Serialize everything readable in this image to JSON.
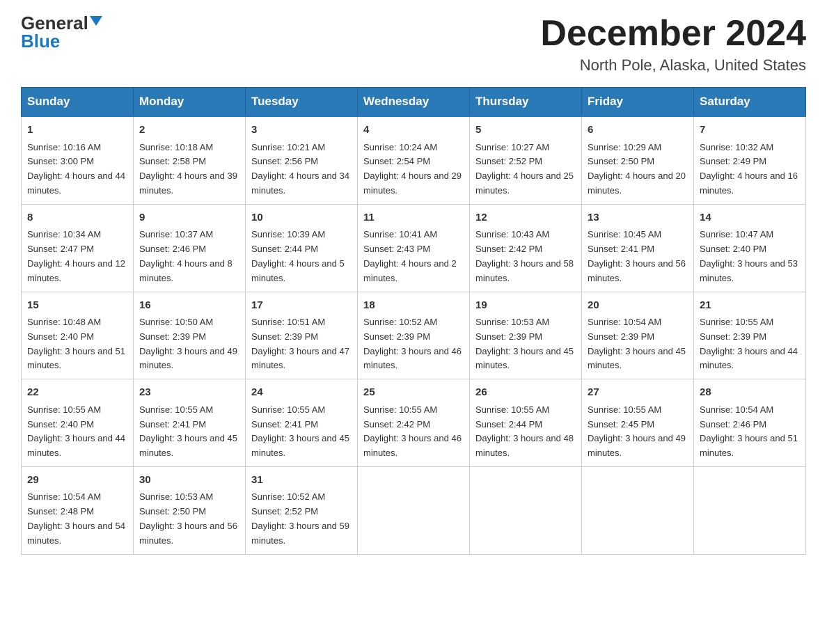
{
  "logo": {
    "general": "General",
    "blue": "Blue"
  },
  "title": "December 2024",
  "subtitle": "North Pole, Alaska, United States",
  "days_of_week": [
    "Sunday",
    "Monday",
    "Tuesday",
    "Wednesday",
    "Thursday",
    "Friday",
    "Saturday"
  ],
  "weeks": [
    [
      {
        "day": "1",
        "sunrise": "10:16 AM",
        "sunset": "3:00 PM",
        "daylight": "4 hours and 44 minutes."
      },
      {
        "day": "2",
        "sunrise": "10:18 AM",
        "sunset": "2:58 PM",
        "daylight": "4 hours and 39 minutes."
      },
      {
        "day": "3",
        "sunrise": "10:21 AM",
        "sunset": "2:56 PM",
        "daylight": "4 hours and 34 minutes."
      },
      {
        "day": "4",
        "sunrise": "10:24 AM",
        "sunset": "2:54 PM",
        "daylight": "4 hours and 29 minutes."
      },
      {
        "day": "5",
        "sunrise": "10:27 AM",
        "sunset": "2:52 PM",
        "daylight": "4 hours and 25 minutes."
      },
      {
        "day": "6",
        "sunrise": "10:29 AM",
        "sunset": "2:50 PM",
        "daylight": "4 hours and 20 minutes."
      },
      {
        "day": "7",
        "sunrise": "10:32 AM",
        "sunset": "2:49 PM",
        "daylight": "4 hours and 16 minutes."
      }
    ],
    [
      {
        "day": "8",
        "sunrise": "10:34 AM",
        "sunset": "2:47 PM",
        "daylight": "4 hours and 12 minutes."
      },
      {
        "day": "9",
        "sunrise": "10:37 AM",
        "sunset": "2:46 PM",
        "daylight": "4 hours and 8 minutes."
      },
      {
        "day": "10",
        "sunrise": "10:39 AM",
        "sunset": "2:44 PM",
        "daylight": "4 hours and 5 minutes."
      },
      {
        "day": "11",
        "sunrise": "10:41 AM",
        "sunset": "2:43 PM",
        "daylight": "4 hours and 2 minutes."
      },
      {
        "day": "12",
        "sunrise": "10:43 AM",
        "sunset": "2:42 PM",
        "daylight": "3 hours and 58 minutes."
      },
      {
        "day": "13",
        "sunrise": "10:45 AM",
        "sunset": "2:41 PM",
        "daylight": "3 hours and 56 minutes."
      },
      {
        "day": "14",
        "sunrise": "10:47 AM",
        "sunset": "2:40 PM",
        "daylight": "3 hours and 53 minutes."
      }
    ],
    [
      {
        "day": "15",
        "sunrise": "10:48 AM",
        "sunset": "2:40 PM",
        "daylight": "3 hours and 51 minutes."
      },
      {
        "day": "16",
        "sunrise": "10:50 AM",
        "sunset": "2:39 PM",
        "daylight": "3 hours and 49 minutes."
      },
      {
        "day": "17",
        "sunrise": "10:51 AM",
        "sunset": "2:39 PM",
        "daylight": "3 hours and 47 minutes."
      },
      {
        "day": "18",
        "sunrise": "10:52 AM",
        "sunset": "2:39 PM",
        "daylight": "3 hours and 46 minutes."
      },
      {
        "day": "19",
        "sunrise": "10:53 AM",
        "sunset": "2:39 PM",
        "daylight": "3 hours and 45 minutes."
      },
      {
        "day": "20",
        "sunrise": "10:54 AM",
        "sunset": "2:39 PM",
        "daylight": "3 hours and 45 minutes."
      },
      {
        "day": "21",
        "sunrise": "10:55 AM",
        "sunset": "2:39 PM",
        "daylight": "3 hours and 44 minutes."
      }
    ],
    [
      {
        "day": "22",
        "sunrise": "10:55 AM",
        "sunset": "2:40 PM",
        "daylight": "3 hours and 44 minutes."
      },
      {
        "day": "23",
        "sunrise": "10:55 AM",
        "sunset": "2:41 PM",
        "daylight": "3 hours and 45 minutes."
      },
      {
        "day": "24",
        "sunrise": "10:55 AM",
        "sunset": "2:41 PM",
        "daylight": "3 hours and 45 minutes."
      },
      {
        "day": "25",
        "sunrise": "10:55 AM",
        "sunset": "2:42 PM",
        "daylight": "3 hours and 46 minutes."
      },
      {
        "day": "26",
        "sunrise": "10:55 AM",
        "sunset": "2:44 PM",
        "daylight": "3 hours and 48 minutes."
      },
      {
        "day": "27",
        "sunrise": "10:55 AM",
        "sunset": "2:45 PM",
        "daylight": "3 hours and 49 minutes."
      },
      {
        "day": "28",
        "sunrise": "10:54 AM",
        "sunset": "2:46 PM",
        "daylight": "3 hours and 51 minutes."
      }
    ],
    [
      {
        "day": "29",
        "sunrise": "10:54 AM",
        "sunset": "2:48 PM",
        "daylight": "3 hours and 54 minutes."
      },
      {
        "day": "30",
        "sunrise": "10:53 AM",
        "sunset": "2:50 PM",
        "daylight": "3 hours and 56 minutes."
      },
      {
        "day": "31",
        "sunrise": "10:52 AM",
        "sunset": "2:52 PM",
        "daylight": "3 hours and 59 minutes."
      },
      null,
      null,
      null,
      null
    ]
  ],
  "sunrise_label": "Sunrise:",
  "sunset_label": "Sunset:",
  "daylight_label": "Daylight:"
}
